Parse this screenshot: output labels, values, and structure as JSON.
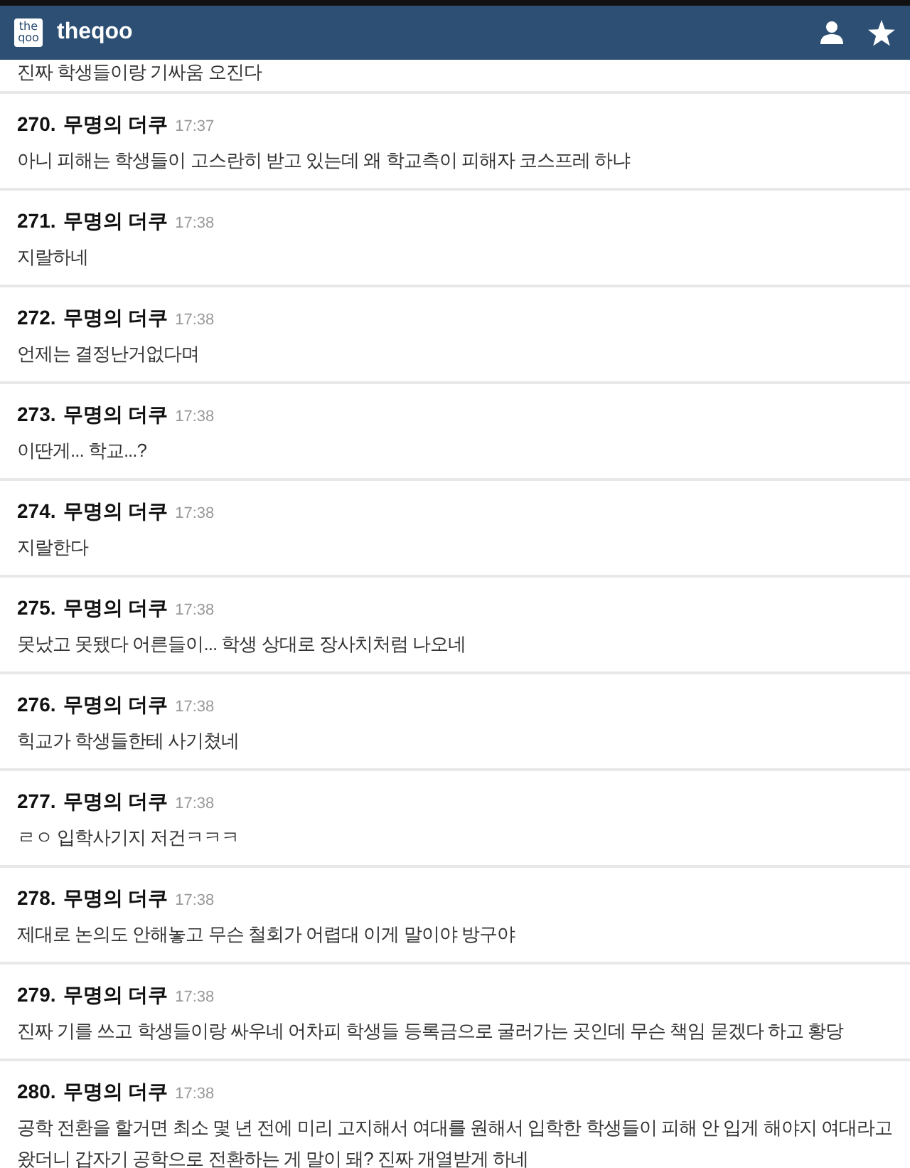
{
  "header": {
    "logo": "the qoo",
    "title": "theqoo"
  },
  "partial_comment": {
    "body": "진짜 학생들이랑 기싸움 오진다"
  },
  "comments": [
    {
      "number": "270.",
      "author": "무명의 더쿠",
      "time": "17:37",
      "body": "아니 피해는 학생들이 고스란히 받고 있는데 왜 학교측이 피해자 코스프레 하냐"
    },
    {
      "number": "271.",
      "author": "무명의 더쿠",
      "time": "17:38",
      "body": "지랄하네"
    },
    {
      "number": "272.",
      "author": "무명의 더쿠",
      "time": "17:38",
      "body": "언제는 결정난거없다며"
    },
    {
      "number": "273.",
      "author": "무명의 더쿠",
      "time": "17:38",
      "body": "이딴게... 학교...?"
    },
    {
      "number": "274.",
      "author": "무명의 더쿠",
      "time": "17:38",
      "body": "지랄한다"
    },
    {
      "number": "275.",
      "author": "무명의 더쿠",
      "time": "17:38",
      "body": "못났고 못됐다 어른들이... 학생 상대로 장사치처럼 나오네"
    },
    {
      "number": "276.",
      "author": "무명의 더쿠",
      "time": "17:38",
      "body": "힉교가 학생들한테 사기쳤네"
    },
    {
      "number": "277.",
      "author": "무명의 더쿠",
      "time": "17:38",
      "body": "ㄹㅇ 입학사기지 저건ㅋㅋㅋ"
    },
    {
      "number": "278.",
      "author": "무명의 더쿠",
      "time": "17:38",
      "body": "제대로 논의도 안해놓고 무슨 철회가 어렵대 이게 말이야 방구야"
    },
    {
      "number": "279.",
      "author": "무명의 더쿠",
      "time": "17:38",
      "body": "진짜 기를 쓰고 학생들이랑 싸우네 어차피 학생들 등록금으로 굴러가는 곳인데 무슨 책임 묻겠다 하고 황당"
    },
    {
      "number": "280.",
      "author": "무명의 더쿠",
      "time": "17:38",
      "body": "공학 전환을 할거면 최소 몇 년 전에 미리 고지해서 여대를 원해서 입학한 학생들이 피해 안 입게 해야지 여대라고 왔더니 갑자기 공학으로 전환하는 게 말이 돼? 진짜 개열받게 하네"
    }
  ]
}
